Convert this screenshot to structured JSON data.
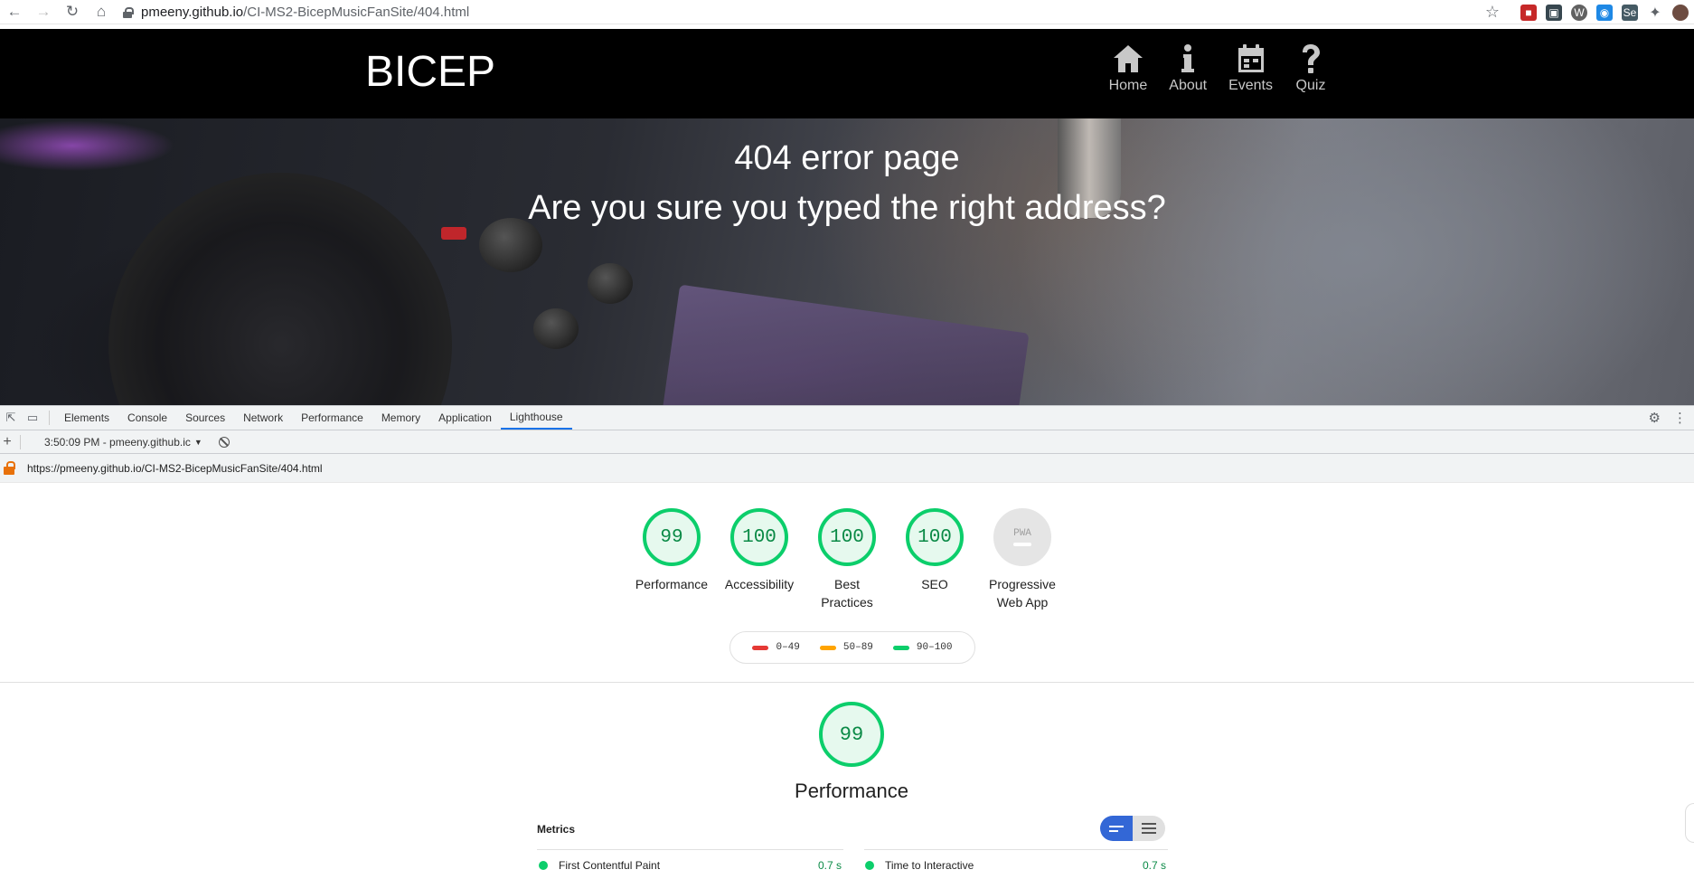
{
  "browser": {
    "url_host": "pmeeny.github.io",
    "url_path": "/CI-MS2-BicepMusicFanSite/404.html"
  },
  "site": {
    "brand": "BICEP",
    "nav": [
      {
        "label": "Home",
        "icon": "home-icon"
      },
      {
        "label": "About",
        "icon": "info-icon"
      },
      {
        "label": "Events",
        "icon": "calendar-icon"
      },
      {
        "label": "Quiz",
        "icon": "question-icon"
      }
    ],
    "hero_title": "404 error page",
    "hero_subtitle": "Are you sure you typed the right address?"
  },
  "devtools": {
    "tabs": [
      "Elements",
      "Console",
      "Sources",
      "Network",
      "Performance",
      "Memory",
      "Application",
      "Lighthouse"
    ],
    "active_tab": "Lighthouse",
    "run_label": "3:50:09 PM - pmeeny.github.ic",
    "report_url": "https://pmeeny.github.io/CI-MS2-BicepMusicFanSite/404.html"
  },
  "report": {
    "scores": [
      {
        "value": "99",
        "label": "Performance"
      },
      {
        "value": "100",
        "label": "Accessibility"
      },
      {
        "value": "100",
        "label": "Best Practices"
      },
      {
        "value": "100",
        "label": "SEO"
      },
      {
        "value": "PWA",
        "label": "Progressive Web App"
      }
    ],
    "legend": [
      {
        "range": "0–49",
        "color": "#e53935"
      },
      {
        "range": "50–89",
        "color": "#ffa400"
      },
      {
        "range": "90–100",
        "color": "#0cce6b"
      }
    ],
    "perf_score": "99",
    "perf_title": "Performance",
    "metrics_heading": "Metrics",
    "metrics": [
      {
        "name": "First Contentful Paint",
        "value": "0.7 s"
      },
      {
        "name": "Time to Interactive",
        "value": "0.7 s"
      }
    ]
  },
  "colors": {
    "pass": "#0cce6b",
    "accent": "#1a73e8",
    "toggle_on": "#3367d6"
  }
}
